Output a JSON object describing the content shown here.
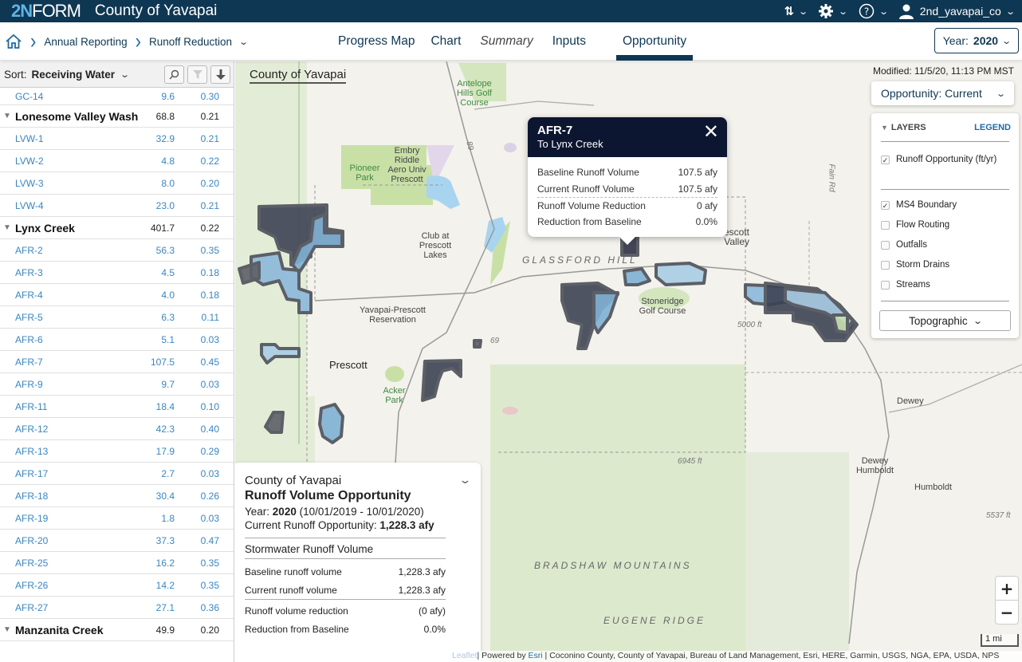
{
  "topbar": {
    "logo_num": "2N",
    "logo_text": "FORM",
    "app_title": "County of Yavapai",
    "sort_icon": "sort-arrows-icon",
    "settings_icon": "gear-icon",
    "help_icon": "help-circle-icon",
    "user_icon": "user-icon",
    "username": "2nd_yavapai_co"
  },
  "nav": {
    "breadcrumbs": [
      "Annual Reporting",
      "Runoff Reduction"
    ],
    "tabs": [
      {
        "label": "Progress Map",
        "active": false
      },
      {
        "label": "Chart",
        "active": false
      },
      {
        "label": "Summary",
        "active": false,
        "italic": true
      },
      {
        "label": "Inputs",
        "active": false
      },
      {
        "label": "Opportunity",
        "active": true
      }
    ],
    "year_label": "Year:",
    "year_value": "2020"
  },
  "sidebar": {
    "sort_label": "Sort:",
    "sort_value": "Receiving Water",
    "rows": [
      {
        "type": "item",
        "name": "GC-14",
        "volume": "9.6",
        "rate": "0.30"
      },
      {
        "type": "group",
        "name": "Lonesome Valley Wash",
        "volume": "68.8",
        "rate": "0.21"
      },
      {
        "type": "item",
        "name": "LVW-1",
        "volume": "32.9",
        "rate": "0.21"
      },
      {
        "type": "item",
        "name": "LVW-2",
        "volume": "4.8",
        "rate": "0.22"
      },
      {
        "type": "item",
        "name": "LVW-3",
        "volume": "8.0",
        "rate": "0.20"
      },
      {
        "type": "item",
        "name": "LVW-4",
        "volume": "23.0",
        "rate": "0.21"
      },
      {
        "type": "group",
        "name": "Lynx Creek",
        "volume": "401.7",
        "rate": "0.22"
      },
      {
        "type": "item",
        "name": "AFR-2",
        "volume": "56.3",
        "rate": "0.35"
      },
      {
        "type": "item",
        "name": "AFR-3",
        "volume": "4.5",
        "rate": "0.18"
      },
      {
        "type": "item",
        "name": "AFR-4",
        "volume": "4.0",
        "rate": "0.18"
      },
      {
        "type": "item",
        "name": "AFR-5",
        "volume": "6.3",
        "rate": "0.11"
      },
      {
        "type": "item",
        "name": "AFR-6",
        "volume": "5.1",
        "rate": "0.03"
      },
      {
        "type": "item",
        "name": "AFR-7",
        "volume": "107.5",
        "rate": "0.45"
      },
      {
        "type": "item",
        "name": "AFR-9",
        "volume": "9.7",
        "rate": "0.03"
      },
      {
        "type": "item",
        "name": "AFR-11",
        "volume": "18.4",
        "rate": "0.10"
      },
      {
        "type": "item",
        "name": "AFR-12",
        "volume": "42.3",
        "rate": "0.40"
      },
      {
        "type": "item",
        "name": "AFR-13",
        "volume": "17.9",
        "rate": "0.29"
      },
      {
        "type": "item",
        "name": "AFR-17",
        "volume": "2.7",
        "rate": "0.03"
      },
      {
        "type": "item",
        "name": "AFR-18",
        "volume": "30.4",
        "rate": "0.26"
      },
      {
        "type": "item",
        "name": "AFR-19",
        "volume": "1.8",
        "rate": "0.03"
      },
      {
        "type": "item",
        "name": "AFR-20",
        "volume": "37.3",
        "rate": "0.47"
      },
      {
        "type": "item",
        "name": "AFR-25",
        "volume": "16.2",
        "rate": "0.35"
      },
      {
        "type": "item",
        "name": "AFR-26",
        "volume": "14.2",
        "rate": "0.35"
      },
      {
        "type": "item",
        "name": "AFR-27",
        "volume": "27.1",
        "rate": "0.36"
      },
      {
        "type": "group",
        "name": "Manzanita Creek",
        "volume": "49.9",
        "rate": "0.20"
      }
    ]
  },
  "map": {
    "title": "County of Yavapai",
    "modified": "Modified: 11/5/20, 11:13 PM MST",
    "opportunity_select": "Opportunity: Current",
    "layers": {
      "header": "LAYERS",
      "legend_link": "LEGEND",
      "items": [
        {
          "label": "Runoff Opportunity (ft/yr)",
          "checked": true
        },
        {
          "label": "MS4 Boundary",
          "checked": true
        },
        {
          "label": "Flow Routing",
          "checked": false
        },
        {
          "label": "Outfalls",
          "checked": false
        },
        {
          "label": "Storm Drains",
          "checked": false
        },
        {
          "label": "Streams",
          "checked": false
        }
      ],
      "basemap": "Topographic"
    },
    "popup": {
      "title": "AFR-7",
      "subtitle": "To Lynx Creek",
      "rows": [
        {
          "label": "Baseline Runoff Volume",
          "value": "107.5 afy"
        },
        {
          "label": "Current Runoff Volume",
          "value": "107.5 afy"
        },
        {
          "label": "Runoff Volume Reduction",
          "value": "0 afy"
        },
        {
          "label": "Reduction from Baseline",
          "value": "0.0%"
        }
      ]
    },
    "summary": {
      "county": "County of Yavapai",
      "title": "Runoff Volume Opportunity",
      "year_label": "Year:",
      "year_value": "2020",
      "year_range": "(10/01/2019 - 10/01/2020)",
      "current_label": "Current Runoff Opportunity:",
      "current_value": "1,228.3 afy",
      "section": "Stormwater Runoff Volume",
      "rows": [
        {
          "label": "Baseline runoff volume",
          "value": "1,228.3 afy"
        },
        {
          "label": "Current runoff volume",
          "value": "1,228.3 afy"
        },
        {
          "label": "Runoff volume reduction",
          "value": "(0 afy)"
        },
        {
          "label": "Reduction from Baseline",
          "value": "0.0%"
        }
      ]
    },
    "labels": [
      {
        "text": "Antelope Hills Golf Course",
        "kind": "green"
      },
      {
        "text": "Embry Riddle Aero Univ Prescott",
        "kind": "normal"
      },
      {
        "text": "Pioneer Park",
        "kind": "green"
      },
      {
        "text": "Club at Prescott Lakes",
        "kind": "normal"
      },
      {
        "text": "GLASSFORD HILL",
        "kind": "mtn"
      },
      {
        "text": "Prescott Valley",
        "kind": "normal"
      },
      {
        "text": "Yavapai-Prescott Reservation",
        "kind": "normal"
      },
      {
        "text": "Stoneridge Golf Course",
        "kind": "normal"
      },
      {
        "text": "Prescott",
        "kind": "city"
      },
      {
        "text": "Acker Park",
        "kind": "green"
      },
      {
        "text": "Dewey",
        "kind": "normal"
      },
      {
        "text": "Dewey Humboldt",
        "kind": "normal"
      },
      {
        "text": "Humboldt",
        "kind": "normal"
      },
      {
        "text": "BRADSHAW MOUNTAINS",
        "kind": "mtn"
      },
      {
        "text": "EUGENE RIDGE",
        "kind": "mtn"
      },
      {
        "text": "6945 ft",
        "kind": "elev"
      },
      {
        "text": "5537 ft",
        "kind": "elev"
      },
      {
        "text": "5000 ft",
        "kind": "elev"
      },
      {
        "text": "Fain Rd",
        "kind": "road"
      },
      {
        "text": "69",
        "kind": "road"
      },
      {
        "text": "89",
        "kind": "road"
      }
    ],
    "zoom_in": "+",
    "zoom_out": "−",
    "scale": "1 mi",
    "attribution": {
      "leaflet": "Leaflet",
      "powered": "| Powered by ",
      "esri": "Esri",
      "sources": " | Coconino County, County of Yavapai, Bureau of Land Management, Esri, HERE, Garmin, USGS, NGA, EPA, USDA, NPS"
    }
  },
  "colors": {
    "brand_navy": "#0e3753",
    "link_blue": "#3a86c0",
    "popup_header": "#0d1631",
    "polygon_dark": "#3d4254",
    "polygon_light": "#9ec7e2",
    "polygon_outline": "#5c5f66"
  }
}
